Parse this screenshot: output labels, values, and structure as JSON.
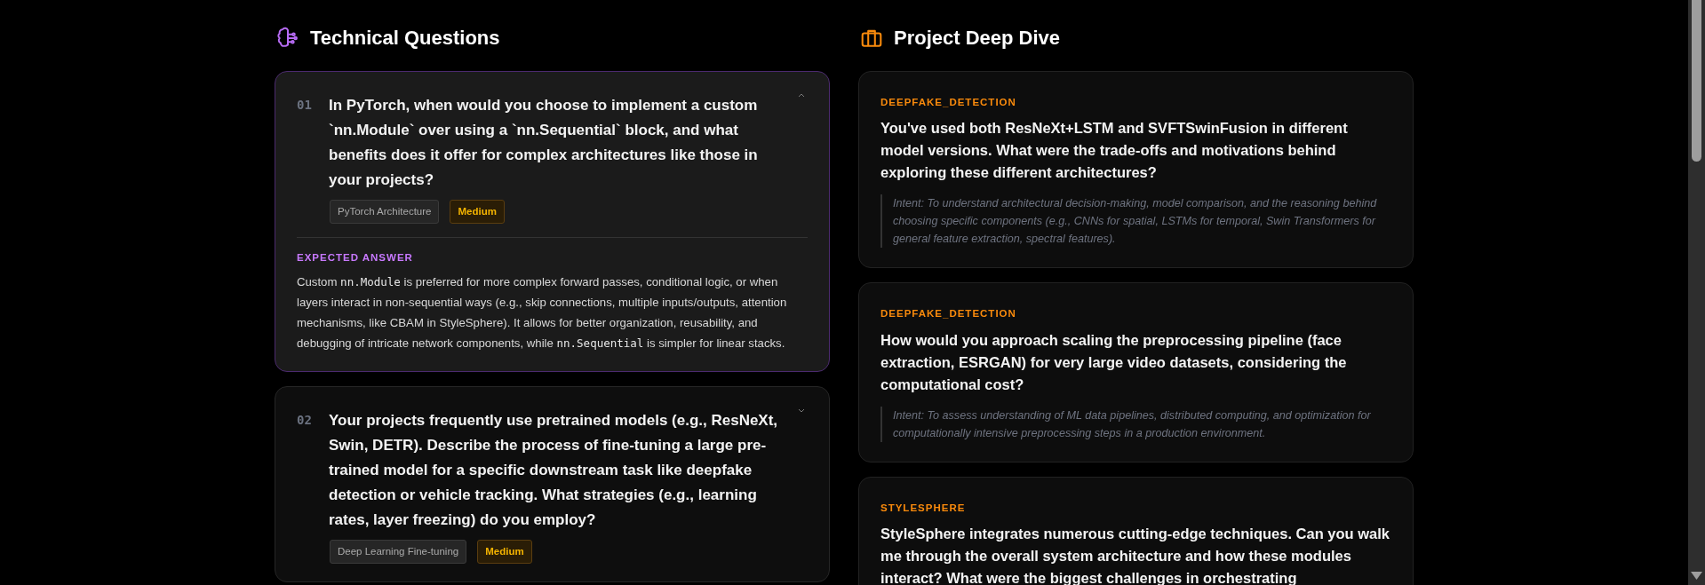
{
  "technical_questions": {
    "title": "Technical Questions",
    "items": [
      {
        "number": "01",
        "question": "In PyTorch, when would you choose to implement a custom `nn.Module` over using a `nn.Sequential` block, and what benefits does it offer for complex architectures like those in your projects?",
        "expanded": true,
        "tags": [
          {
            "label": "PyTorch Architecture",
            "kind": "topic"
          },
          {
            "label": "Medium",
            "kind": "difficulty"
          }
        ],
        "answer_label": "EXPECTED ANSWER",
        "answer": [
          {
            "text": "Custom ",
            "code": false
          },
          {
            "text": "nn.Module",
            "code": true
          },
          {
            "text": " is preferred for more complex forward passes, conditional logic, or when layers interact in non-sequential ways (e.g., skip connections, multiple inputs/outputs, attention mechanisms, like CBAM in StyleSphere). It allows for better organization, reusability, and debugging of intricate network components, while ",
            "code": false
          },
          {
            "text": "nn.Sequential",
            "code": true
          },
          {
            "text": " is simpler for linear stacks.",
            "code": false
          }
        ]
      },
      {
        "number": "02",
        "question": "Your projects frequently use pretrained models (e.g., ResNeXt, Swin, DETR). Describe the process of fine-tuning a large pre-trained model for a specific downstream task like deepfake detection or vehicle tracking. What strategies (e.g., learning rates, layer freezing) do you employ?",
        "expanded": false,
        "tags": [
          {
            "label": "Deep Learning Fine-tuning",
            "kind": "topic"
          },
          {
            "label": "Medium",
            "kind": "difficulty"
          }
        ]
      }
    ]
  },
  "project_deep_dive": {
    "title": "Project Deep Dive",
    "items": [
      {
        "category": "DEEPFAKE_DETECTION",
        "question": "You've used both ResNeXt+LSTM and SVFTSwinFusion in different model versions. What were the trade-offs and motivations behind exploring these different architectures?",
        "intent": "Intent: To understand architectural decision-making, model comparison, and the reasoning behind choosing specific components (e.g., CNNs for spatial, LSTMs for temporal, Swin Transformers for general feature extraction, spectral features)."
      },
      {
        "category": "DEEPFAKE_DETECTION",
        "question": "How would you approach scaling the preprocessing pipeline (face extraction, ESRGAN) for very large video datasets, considering the computational cost?",
        "intent": "Intent: To assess understanding of ML data pipelines, distributed computing, and optimization for computationally intensive preprocessing steps in a production environment."
      },
      {
        "category": "STYLESPHERE",
        "question": "StyleSphere integrates numerous cutting-edge techniques. Can you walk me through the overall system architecture and how these modules interact? What were the biggest challenges in orchestrating"
      }
    ]
  }
}
